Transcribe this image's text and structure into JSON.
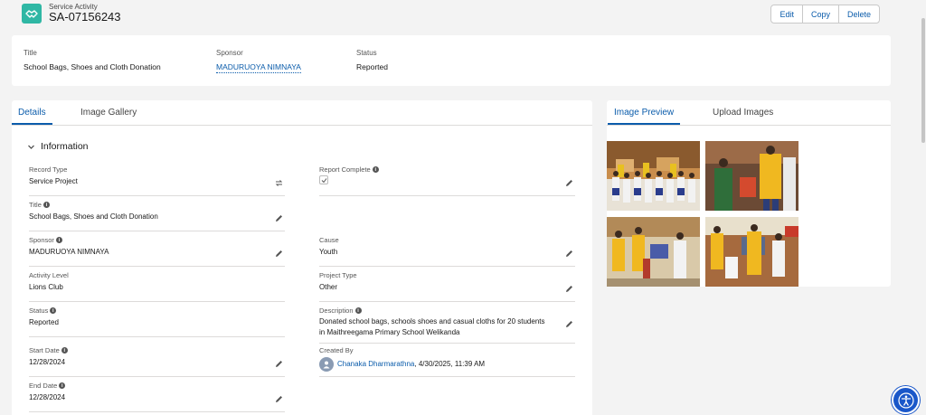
{
  "record": {
    "object_type": "Service Activity",
    "name": "SA-07156243",
    "icon": "handshake-icon"
  },
  "actions": {
    "edit": "Edit",
    "copy": "Copy",
    "delete": "Delete"
  },
  "highlights": {
    "title_label": "Title",
    "title_value": "School Bags, Shoes and Cloth Donation",
    "sponsor_label": "Sponsor",
    "sponsor_value": "MADURUOYA NIMNAYA",
    "status_label": "Status",
    "status_value": "Reported"
  },
  "left_tabs": {
    "details": "Details",
    "gallery": "Image Gallery"
  },
  "section": {
    "title": "Information"
  },
  "fields": {
    "record_type": {
      "label": "Record Type",
      "value": "Service Project"
    },
    "report_complete": {
      "label": "Report Complete",
      "checked": true
    },
    "title": {
      "label": "Title",
      "value": "School Bags, Shoes and Cloth Donation"
    },
    "sponsor": {
      "label": "Sponsor",
      "value": "MADURUOYA NIMNAYA"
    },
    "cause": {
      "label": "Cause",
      "value": "Youth"
    },
    "activity_level": {
      "label": "Activity Level",
      "value": "Lions Club"
    },
    "project_type": {
      "label": "Project Type",
      "value": "Other"
    },
    "status": {
      "label": "Status",
      "value": "Reported"
    },
    "description": {
      "label": "Description",
      "value": "Donated school bags, schools shoes and casual cloths for 20 students in Maithreegama Primary School Welikanda"
    },
    "start_date": {
      "label": "Start Date",
      "value": "12/28/2024"
    },
    "created_by": {
      "label": "Created By",
      "user": "Chanaka Dharmarathna",
      "date": ", 4/30/2025, 11:39 AM"
    },
    "end_date": {
      "label": "End Date",
      "value": "12/28/2024"
    }
  },
  "right_tabs": {
    "preview": "Image Preview",
    "upload": "Upload Images"
  },
  "colors": {
    "brand": "#0b5cab",
    "object_icon": "#2fb7a4",
    "accessibility_button": "#1a57c9"
  }
}
